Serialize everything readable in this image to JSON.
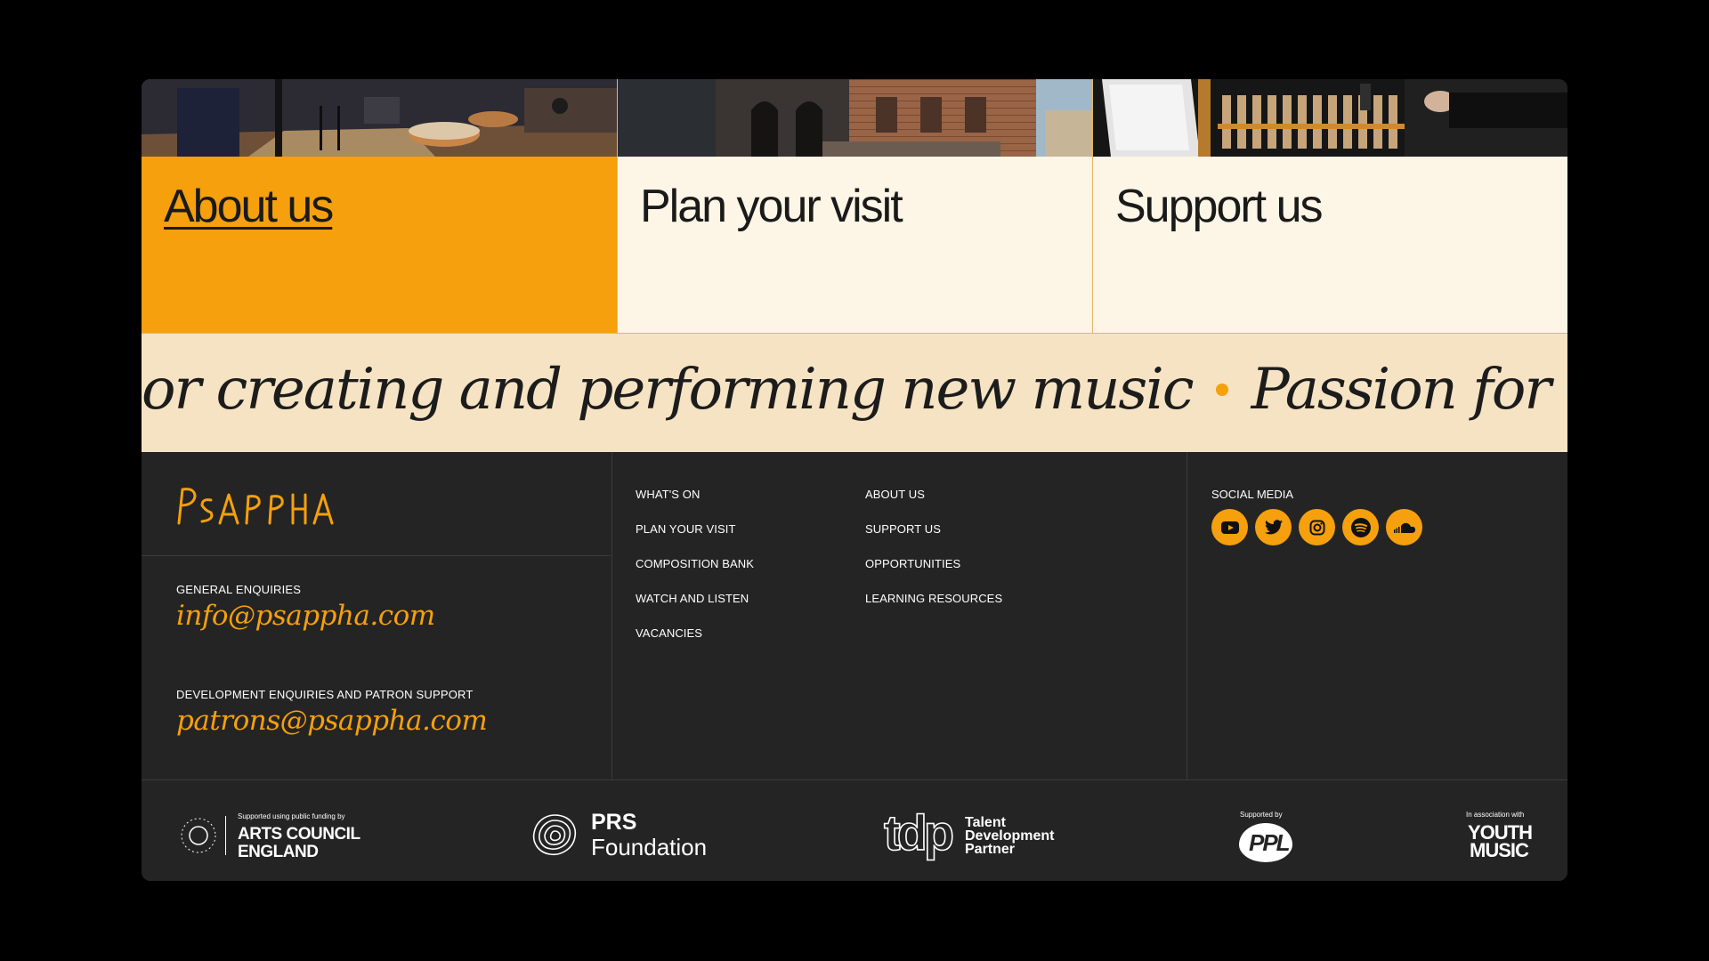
{
  "cards": [
    {
      "title": "About us",
      "active": true,
      "bg": "#f5a00c"
    },
    {
      "title": "Plan your visit",
      "active": false,
      "bg": "#fdf5e6"
    },
    {
      "title": "Support us",
      "active": false,
      "bg": "#fdf5e6"
    }
  ],
  "ticker": {
    "segment_a": "or creating and performing new music",
    "segment_b": "Passion for creating and"
  },
  "footer": {
    "logo_text": "PSAPPHA",
    "general_label": "GENERAL ENQUIRIES",
    "general_email": "info@psappha.com",
    "dev_label": "DEVELOPMENT ENQUIRIES AND PATRON SUPPORT",
    "dev_email": "patrons@psappha.com",
    "nav_col1": [
      "WHAT'S ON",
      "PLAN YOUR VISIT",
      "COMPOSITION BANK",
      "WATCH AND LISTEN",
      "VACANCIES"
    ],
    "nav_col2": [
      "ABOUT US",
      "SUPPORT US",
      "OPPORTUNITIES",
      "LEARNING RESOURCES"
    ],
    "social_label": "SOCIAL MEDIA",
    "social_icons": [
      "youtube-icon",
      "twitter-icon",
      "instagram-icon",
      "spotify-icon",
      "soundcloud-icon"
    ]
  },
  "sponsors": {
    "ace_small": "Supported using public funding by",
    "ace_line1": "ARTS COUNCIL",
    "ace_line2": "ENGLAND",
    "ace_ring": "ARTS COUNCIL ENGLAND",
    "prs_line1": "PRS",
    "prs_line2": "Foundation",
    "tdp_mark": "tdp",
    "tdp_line1": "Talent",
    "tdp_line2": "Development",
    "tdp_line3": "Partner",
    "ppl_small": "Supported by",
    "ppl_mark": "PPL",
    "ym_small": "In association with",
    "ym_line1": "YOUTH",
    "ym_line2": "MUSIC"
  },
  "colors": {
    "accent": "#f5a00c",
    "cream": "#fdf5e6",
    "ticker_bg": "#f5e3c3",
    "footer_bg": "#242424"
  }
}
